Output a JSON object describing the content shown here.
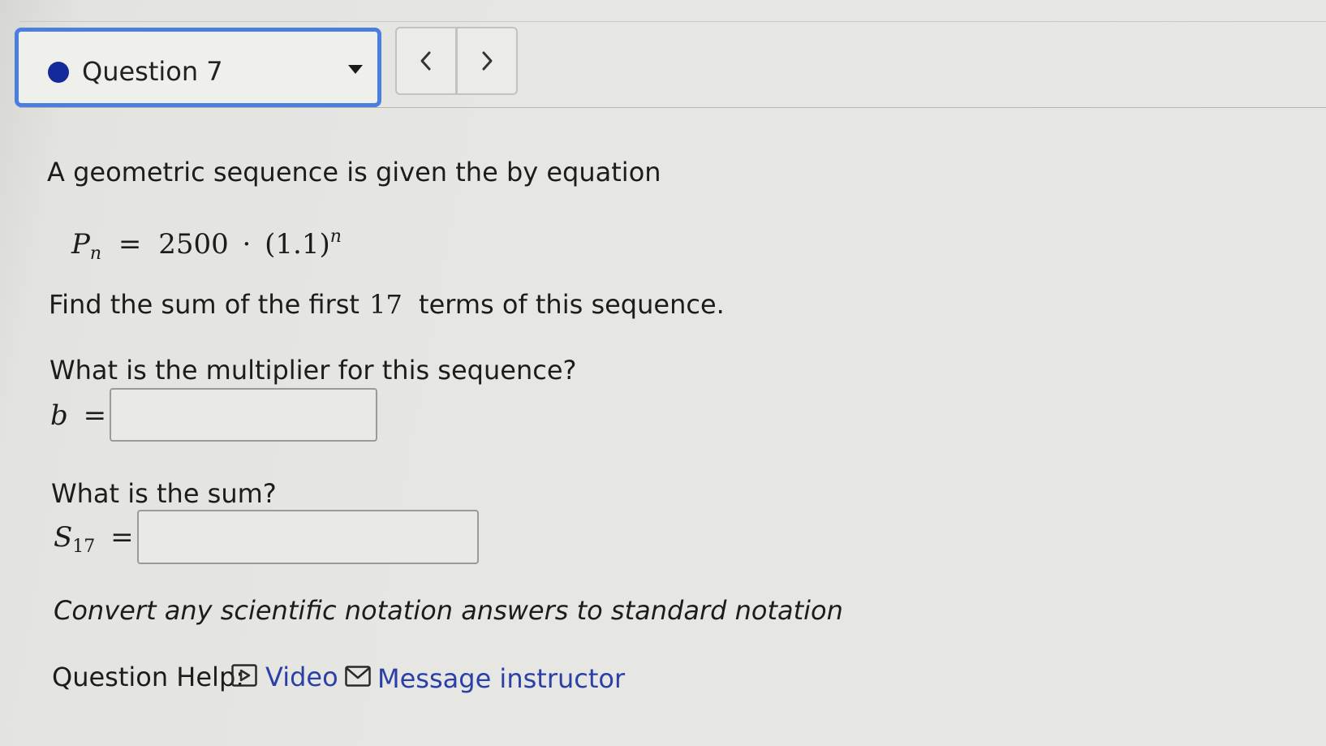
{
  "header": {
    "question_selector_label": "Question 7",
    "prev_symbol": "<",
    "next_symbol": ">"
  },
  "problem": {
    "intro": "A geometric sequence is given the by equation",
    "equation": {
      "lhs_var": "P",
      "lhs_sub": "n",
      "rhs_coeff": "2500",
      "rhs_base": "(1.1)",
      "rhs_exp": "n"
    },
    "task_before": "Find the sum of the first",
    "task_number": "17",
    "task_after": "terms of this sequence.",
    "multiplier_question": "What is the multiplier for this sequence?",
    "multiplier_var": "b",
    "multiplier_value": "",
    "sum_question": "What is the sum?",
    "sum_var": "S",
    "sum_sub": "17",
    "sum_value": "",
    "equals": "=",
    "note": "Convert any scientific notation answers to standard notation"
  },
  "help": {
    "label": "Question Help:",
    "video_label": "Video",
    "video_icon": "video-play-icon",
    "message_label": "Message instructor",
    "message_icon": "envelope-icon"
  },
  "colors": {
    "selector_border": "#4a7fe0",
    "status_dot": "#142a9a",
    "link": "#2b3fa8"
  }
}
